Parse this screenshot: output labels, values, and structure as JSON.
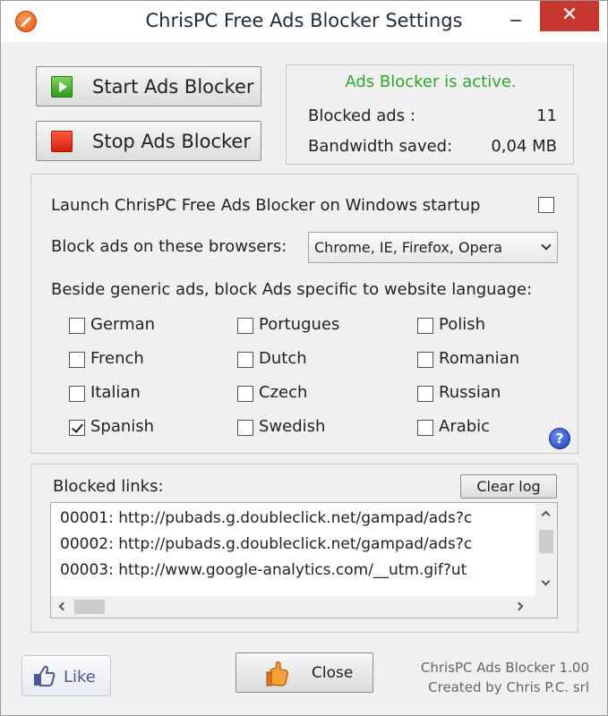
{
  "window": {
    "title": "ChrisPC Free Ads Blocker Settings"
  },
  "controls": {
    "start_label": "Start Ads Blocker",
    "stop_label": "Stop Ads Blocker"
  },
  "status": {
    "state_text": "Ads Blocker is active.",
    "blocked_label": "Blocked ads :",
    "blocked_value": "11",
    "bandwidth_label": "Bandwidth saved:",
    "bandwidth_value": "0,04 MB",
    "accent_color": "#2ea52e"
  },
  "settings": {
    "startup_label": "Launch ChrisPC Free Ads Blocker on Windows startup",
    "startup_checked": false,
    "browsers_label": "Block ads on these browsers:",
    "browsers_selected": "Chrome, IE, Firefox, Opera",
    "language_label": "Beside generic ads, block Ads specific to website language:",
    "languages": [
      {
        "label": "German",
        "checked": false
      },
      {
        "label": "Portugues",
        "checked": false
      },
      {
        "label": "Polish",
        "checked": false
      },
      {
        "label": "French",
        "checked": false
      },
      {
        "label": "Dutch",
        "checked": false
      },
      {
        "label": "Romanian",
        "checked": false
      },
      {
        "label": "Italian",
        "checked": false
      },
      {
        "label": "Czech",
        "checked": false
      },
      {
        "label": "Russian",
        "checked": false
      },
      {
        "label": "Spanish",
        "checked": true
      },
      {
        "label": "Swedish",
        "checked": false
      },
      {
        "label": "Arabic",
        "checked": false
      }
    ],
    "help_glyph": "?"
  },
  "links": {
    "label": "Blocked links:",
    "clear_label": "Clear log",
    "rows": [
      "00001: http://pubads.g.doubleclick.net/gampad/ads?c",
      "00002: http://pubads.g.doubleclick.net/gampad/ads?c",
      "00003: http://www.google-analytics.com/__utm.gif?ut"
    ]
  },
  "footer": {
    "like_label": "Like",
    "close_label": "Close",
    "version": "ChrisPC Ads Blocker 1.00",
    "creator": "Created by Chris P.C. srl"
  },
  "icons": {
    "app": "app-logo-icon",
    "start": "play-icon",
    "stop": "stop-icon",
    "help": "help-icon",
    "like": "thumbs-up-icon",
    "close": "hand-icon"
  }
}
